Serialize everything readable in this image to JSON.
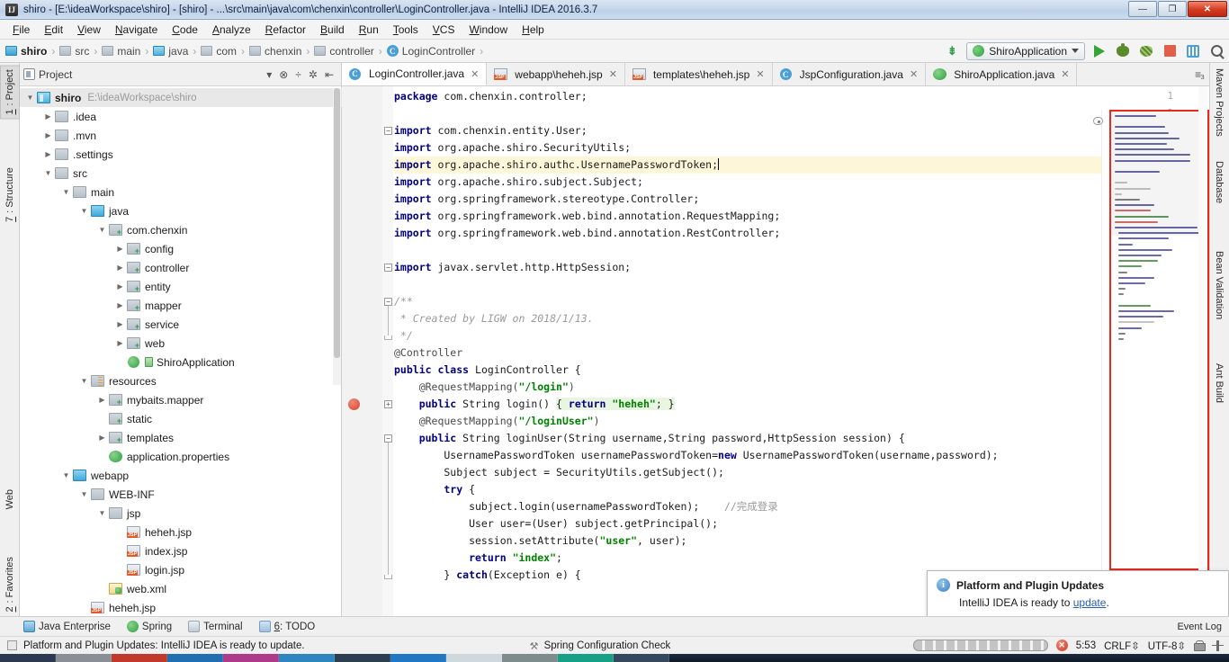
{
  "window": {
    "title": "shiro - [E:\\ideaWorkspace\\shiro] - [shiro] - ...\\src\\main\\java\\com\\chenxin\\controller\\LoginController.java - IntelliJ IDEA 2016.3.7",
    "app_icon": "IJ",
    "minimize_label": "—",
    "maximize_label": "❐",
    "close_label": "✕"
  },
  "menu": [
    {
      "label": "File"
    },
    {
      "label": "Edit"
    },
    {
      "label": "View"
    },
    {
      "label": "Navigate"
    },
    {
      "label": "Code"
    },
    {
      "label": "Analyze"
    },
    {
      "label": "Refactor"
    },
    {
      "label": "Build"
    },
    {
      "label": "Run"
    },
    {
      "label": "Tools"
    },
    {
      "label": "VCS"
    },
    {
      "label": "Window"
    },
    {
      "label": "Help"
    }
  ],
  "breadcrumb": [
    {
      "label": "shiro",
      "icon": "module-icon"
    },
    {
      "label": "src",
      "icon": "folder-icon"
    },
    {
      "label": "main",
      "icon": "folder-icon"
    },
    {
      "label": "java",
      "icon": "source-folder-icon"
    },
    {
      "label": "com",
      "icon": "package-icon"
    },
    {
      "label": "chenxin",
      "icon": "package-icon"
    },
    {
      "label": "controller",
      "icon": "package-icon"
    },
    {
      "label": "LoginController",
      "icon": "class-icon"
    }
  ],
  "toolbar": {
    "run_config": "ShiroApplication",
    "update_arrow_icon": "download-arrow-icon",
    "run_icon": "run-icon",
    "debug_icon": "debug-icon",
    "coverage_icon": "run-with-coverage-icon",
    "stop_icon": "stop-icon",
    "layout_icon": "layout-icon",
    "search_icon": "search-everywhere-icon"
  },
  "left_strip": [
    {
      "label": "1: Project",
      "selected": true
    },
    {
      "label": "7: Structure",
      "selected": false
    },
    {
      "label": "Web",
      "selected": false
    },
    {
      "label": "2: Favorites",
      "selected": false
    }
  ],
  "right_strip": [
    {
      "label": "Maven Projects"
    },
    {
      "label": "Database"
    },
    {
      "label": "Bean Validation"
    },
    {
      "label": "Ant Build"
    }
  ],
  "project_panel": {
    "title": "Project",
    "collapse_icon": "collapse-all-icon",
    "expand_icon": "expand-all-icon",
    "settings_icon": "gear-icon",
    "hide_icon": "hide-icon",
    "dropdown_icon": "chevron-down-icon",
    "tree": [
      {
        "label": "shiro",
        "path": "E:\\ideaWorkspace\\shiro",
        "depth": 0,
        "arrow": "down",
        "icon": "module",
        "bold": true,
        "selected": true
      },
      {
        "label": ".idea",
        "path": "",
        "depth": 1,
        "arrow": "right",
        "icon": "folder",
        "bold": false,
        "selected": false
      },
      {
        "label": ".mvn",
        "path": "",
        "depth": 1,
        "arrow": "right",
        "icon": "folder",
        "bold": false,
        "selected": false
      },
      {
        "label": ".settings",
        "path": "",
        "depth": 1,
        "arrow": "right",
        "icon": "folder",
        "bold": false,
        "selected": false
      },
      {
        "label": "src",
        "path": "",
        "depth": 1,
        "arrow": "down",
        "icon": "folder",
        "bold": false,
        "selected": false
      },
      {
        "label": "main",
        "path": "",
        "depth": 2,
        "arrow": "down",
        "icon": "folder",
        "bold": false,
        "selected": false
      },
      {
        "label": "java",
        "path": "",
        "depth": 3,
        "arrow": "down",
        "icon": "source-folder",
        "bold": false,
        "selected": false
      },
      {
        "label": "com.chenxin",
        "path": "",
        "depth": 4,
        "arrow": "down",
        "icon": "package",
        "bold": false,
        "selected": false
      },
      {
        "label": "config",
        "path": "",
        "depth": 5,
        "arrow": "right",
        "icon": "package",
        "bold": false,
        "selected": false
      },
      {
        "label": "controller",
        "path": "",
        "depth": 5,
        "arrow": "right",
        "icon": "package",
        "bold": false,
        "selected": false
      },
      {
        "label": "entity",
        "path": "",
        "depth": 5,
        "arrow": "right",
        "icon": "package",
        "bold": false,
        "selected": false
      },
      {
        "label": "mapper",
        "path": "",
        "depth": 5,
        "arrow": "right",
        "icon": "package",
        "bold": false,
        "selected": false
      },
      {
        "label": "service",
        "path": "",
        "depth": 5,
        "arrow": "right",
        "icon": "package",
        "bold": false,
        "selected": false
      },
      {
        "label": "web",
        "path": "",
        "depth": 5,
        "arrow": "right",
        "icon": "package",
        "bold": false,
        "selected": false
      },
      {
        "label": "ShiroApplication",
        "path": "",
        "depth": 5,
        "arrow": "none",
        "icon": "spring-class",
        "bold": false,
        "selected": false
      },
      {
        "label": "resources",
        "path": "",
        "depth": 3,
        "arrow": "down",
        "icon": "resources",
        "bold": false,
        "selected": false
      },
      {
        "label": "mybaits.mapper",
        "path": "",
        "depth": 4,
        "arrow": "right",
        "icon": "package",
        "bold": false,
        "selected": false
      },
      {
        "label": "static",
        "path": "",
        "depth": 4,
        "arrow": "none",
        "icon": "package",
        "bold": false,
        "selected": false
      },
      {
        "label": "templates",
        "path": "",
        "depth": 4,
        "arrow": "right",
        "icon": "package",
        "bold": false,
        "selected": false
      },
      {
        "label": "application.properties",
        "path": "",
        "depth": 4,
        "arrow": "none",
        "icon": "spring-file",
        "bold": false,
        "selected": false
      },
      {
        "label": "webapp",
        "path": "",
        "depth": 2,
        "arrow": "down",
        "icon": "source-folder",
        "bold": false,
        "selected": false
      },
      {
        "label": "WEB-INF",
        "path": "",
        "depth": 3,
        "arrow": "down",
        "icon": "folder",
        "bold": false,
        "selected": false
      },
      {
        "label": "jsp",
        "path": "",
        "depth": 4,
        "arrow": "down",
        "icon": "folder",
        "bold": false,
        "selected": false
      },
      {
        "label": "heheh.jsp",
        "path": "",
        "depth": 5,
        "arrow": "none",
        "icon": "jsp",
        "bold": false,
        "selected": false
      },
      {
        "label": "index.jsp",
        "path": "",
        "depth": 5,
        "arrow": "none",
        "icon": "jsp",
        "bold": false,
        "selected": false
      },
      {
        "label": "login.jsp",
        "path": "",
        "depth": 5,
        "arrow": "none",
        "icon": "jsp",
        "bold": false,
        "selected": false
      },
      {
        "label": "web.xml",
        "path": "",
        "depth": 4,
        "arrow": "none",
        "icon": "xml",
        "bold": false,
        "selected": false
      },
      {
        "label": "heheh.jsp",
        "path": "",
        "depth": 3,
        "arrow": "none",
        "icon": "jsp",
        "bold": false,
        "selected": false
      }
    ]
  },
  "editor": {
    "tabs": [
      {
        "label": "LoginController.java",
        "icon": "java-class-icon",
        "active": true
      },
      {
        "label": "webapp\\heheh.jsp",
        "icon": "jsp-icon",
        "active": false
      },
      {
        "label": "templates\\heheh.jsp",
        "icon": "jsp-icon",
        "active": false
      },
      {
        "label": "JspConfiguration.java",
        "icon": "java-class-icon",
        "active": false
      },
      {
        "label": "ShiroApplication.java",
        "icon": "spring-class-icon",
        "active": false
      }
    ],
    "caret_line": 5,
    "breakpoint_line": 19,
    "code_lines": [
      {
        "n": 1,
        "segs": [
          {
            "t": "package ",
            "c": "kw"
          },
          {
            "t": "com.chenxin.controller;",
            "c": "plain"
          }
        ]
      },
      {
        "n": 2,
        "segs": []
      },
      {
        "n": 3,
        "segs": [
          {
            "t": "import ",
            "c": "kw"
          },
          {
            "t": "com.chenxin.entity.User;",
            "c": "plain"
          }
        ]
      },
      {
        "n": 4,
        "segs": [
          {
            "t": "import ",
            "c": "kw"
          },
          {
            "t": "org.apache.shiro.SecurityUtils;",
            "c": "plain"
          }
        ]
      },
      {
        "n": 5,
        "segs": [
          {
            "t": "import ",
            "c": "kw"
          },
          {
            "t": "org.apache.shiro.authc.UsernamePasswordToken;",
            "c": "plain"
          }
        ]
      },
      {
        "n": 6,
        "segs": [
          {
            "t": "import ",
            "c": "kw"
          },
          {
            "t": "org.apache.shiro.subject.Subject;",
            "c": "plain"
          }
        ]
      },
      {
        "n": 7,
        "segs": [
          {
            "t": "import ",
            "c": "kw"
          },
          {
            "t": "org.springframework.stereotype.Controller;",
            "c": "plain"
          }
        ]
      },
      {
        "n": 8,
        "segs": [
          {
            "t": "import ",
            "c": "kw"
          },
          {
            "t": "org.springframework.web.bind.annotation.RequestMapping;",
            "c": "plain"
          }
        ]
      },
      {
        "n": 9,
        "segs": [
          {
            "t": "import ",
            "c": "kw"
          },
          {
            "t": "org.springframework.web.bind.annotation.RestController;",
            "c": "plain"
          }
        ]
      },
      {
        "n": 10,
        "segs": []
      },
      {
        "n": 11,
        "segs": [
          {
            "t": "import ",
            "c": "kw"
          },
          {
            "t": "javax.servlet.http.HttpSession;",
            "c": "plain"
          }
        ]
      },
      {
        "n": 12,
        "segs": []
      },
      {
        "n": 13,
        "segs": [
          {
            "t": "/**",
            "c": "cmt"
          }
        ]
      },
      {
        "n": 14,
        "segs": [
          {
            "t": " * Created by LIGW on 2018/1/13.",
            "c": "cmt"
          }
        ]
      },
      {
        "n": 15,
        "segs": [
          {
            "t": " */",
            "c": "cmt"
          }
        ]
      },
      {
        "n": 16,
        "segs": [
          {
            "t": "@Controller",
            "c": "anno"
          }
        ]
      },
      {
        "n": 17,
        "segs": [
          {
            "t": "public class ",
            "c": "kw"
          },
          {
            "t": "LoginController {",
            "c": "plain"
          }
        ]
      },
      {
        "n": 18,
        "segs": [
          {
            "t": "    @RequestMapping(",
            "c": "anno"
          },
          {
            "t": "\"/login\"",
            "c": "str"
          },
          {
            "t": ")",
            "c": "anno"
          }
        ]
      },
      {
        "n": 19,
        "segs": [
          {
            "t": "    public ",
            "c": "kw"
          },
          {
            "t": "String login() ",
            "c": "plain"
          },
          {
            "t": "{ ",
            "c": "plain"
          },
          {
            "t": "return ",
            "c": "kw"
          },
          {
            "t": "\"heheh\"",
            "c": "str"
          },
          {
            "t": "; }",
            "c": "plain"
          }
        ]
      },
      {
        "n": 22,
        "segs": [
          {
            "t": "    @RequestMapping(",
            "c": "anno"
          },
          {
            "t": "\"/loginUser\"",
            "c": "str"
          },
          {
            "t": ")",
            "c": "anno"
          }
        ]
      },
      {
        "n": 23,
        "segs": [
          {
            "t": "    public ",
            "c": "kw"
          },
          {
            "t": "String loginUser(String username,String password,HttpSession session) {",
            "c": "plain"
          }
        ]
      },
      {
        "n": 24,
        "segs": [
          {
            "t": "        UsernamePasswordToken usernamePasswordToken=",
            "c": "plain"
          },
          {
            "t": "new ",
            "c": "kw"
          },
          {
            "t": "UsernamePasswordToken(username,password);",
            "c": "plain"
          }
        ]
      },
      {
        "n": 25,
        "segs": [
          {
            "t": "        Subject subject = SecurityUtils.getSubject();",
            "c": "plain"
          }
        ]
      },
      {
        "n": 26,
        "segs": [
          {
            "t": "        try ",
            "c": "kw"
          },
          {
            "t": "{",
            "c": "plain"
          }
        ]
      },
      {
        "n": 27,
        "segs": [
          {
            "t": "            subject.login(usernamePasswordToken);    ",
            "c": "plain"
          },
          {
            "t": "//完成登录",
            "c": "cmt2"
          }
        ]
      },
      {
        "n": 28,
        "segs": [
          {
            "t": "            User user=(User) subject.getPrincipal();",
            "c": "plain"
          }
        ]
      },
      {
        "n": 29,
        "segs": [
          {
            "t": "            session.setAttribute(",
            "c": "plain"
          },
          {
            "t": "\"user\"",
            "c": "str"
          },
          {
            "t": ", user);",
            "c": "plain"
          }
        ]
      },
      {
        "n": 30,
        "segs": [
          {
            "t": "            return ",
            "c": "kw"
          },
          {
            "t": "\"index\"",
            "c": "str"
          },
          {
            "t": ";",
            "c": "plain"
          }
        ]
      },
      {
        "n": 31,
        "segs": [
          {
            "t": "        } ",
            "c": "plain"
          },
          {
            "t": "catch",
            "c": "kw"
          },
          {
            "t": "(Exception e) {",
            "c": "plain"
          }
        ]
      }
    ]
  },
  "notification": {
    "icon": "info-icon",
    "title": "Platform and Plugin Updates",
    "body_prefix": "IntelliJ IDEA is ready to ",
    "link": "update",
    "body_suffix": "."
  },
  "bottom_bar": [
    {
      "label": "Java Enterprise",
      "icon": "java-enterprise-icon"
    },
    {
      "label": "Spring",
      "icon": "spring-icon"
    },
    {
      "label": "Terminal",
      "icon": "terminal-icon"
    },
    {
      "label": "6: TODO",
      "icon": "todo-icon"
    }
  ],
  "bottom_bar_right": {
    "label": "Event Log",
    "icon": "event-log-icon"
  },
  "status_bar": {
    "message": "Platform and Plugin Updates: IntelliJ IDEA is ready to update.",
    "center_task": "Spring Configuration Check",
    "caret_position": "5:53",
    "line_separator": "CRLF",
    "encoding": "UTF-8",
    "lock_icon": "lock-icon",
    "hierarchy_icon": "hierarchy-icon",
    "error_icon": "error-icon",
    "memory_icon": "memory-indicator"
  },
  "colors": {
    "accent_blue": "#4a9fd4",
    "keyword": "#000080",
    "string": "#008000",
    "comment": "#9a9a9a",
    "caret_line": "#fdf6d8",
    "minimap_box": "#e8291c",
    "close_button": "#d43b21"
  }
}
